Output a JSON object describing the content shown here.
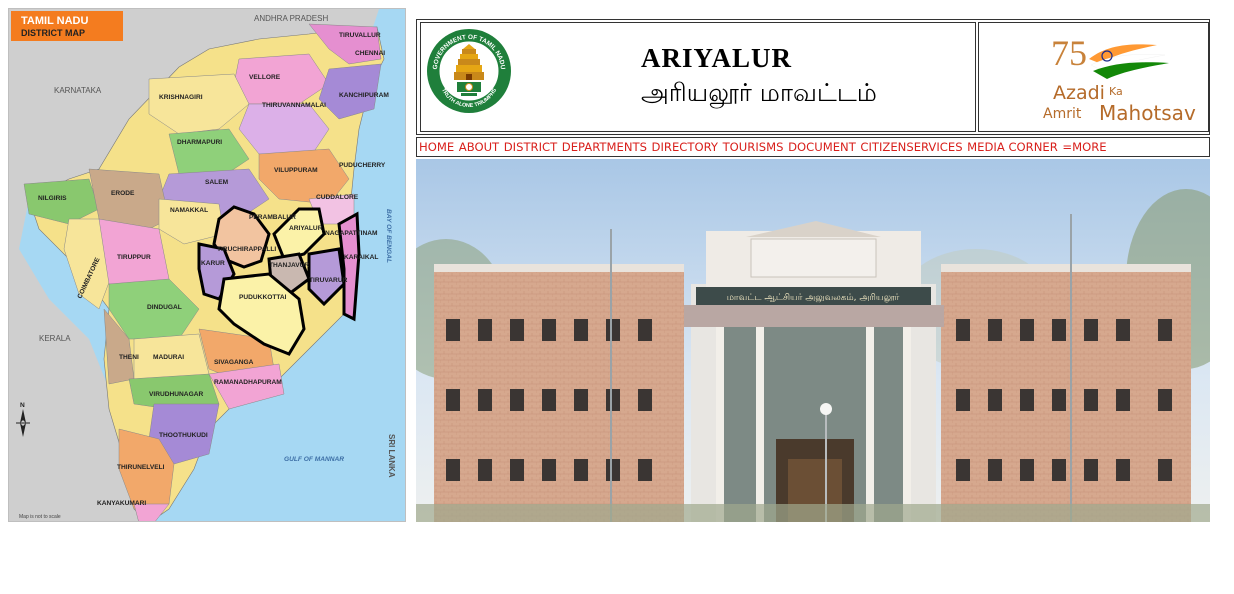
{
  "map": {
    "title_line1": "TAMIL NADU",
    "title_line2": "DISTRICT MAP",
    "note": "Map is not to scale",
    "neighbours": [
      "ANDHRA PRADESH",
      "KARNATAKA",
      "KERALA",
      "SRI LANKA"
    ],
    "seas": [
      "BAY OF BENGAL",
      "GULF OF MANNAR"
    ],
    "puducherry": "PUDUCHERRY",
    "karaikal": "KARAIKAL",
    "north_marker": "N",
    "districts": [
      "TIRUVALLUR",
      "CHENNAI",
      "VELLORE",
      "KANCHIPURAM",
      "KRISHNAGIRI",
      "THIRUVANNAMALAI",
      "DHARMAPURI",
      "VILUPPURAM",
      "SALEM",
      "CUDDALORE",
      "NILGIRIS",
      "ERODE",
      "NAMAKKAL",
      "PERAMBALUR",
      "ARIYALUR",
      "NAGAPATTINAM",
      "TIRUPPUR",
      "COIMBATORE",
      "KARUR",
      "TIRUCHIRAPPALLI",
      "THANJAVUR",
      "TIRUVARUR",
      "DINDUGAL",
      "PUDUKKOTTAI",
      "THENI",
      "MADURAI",
      "SIVAGANGA",
      "VIRUDHUNAGAR",
      "RAMANADHAPURAM",
      "THOOTHUKUDI",
      "THIRUNELVELI",
      "KANYAKUMARI"
    ],
    "highlight_color": "#000000"
  },
  "site": {
    "district_name_en": "ARIYALUR",
    "district_name_ta": "அரியலூர் மாவட்டம்",
    "emblem": {
      "top_text": "GOVERNMENT OF TAMIL NADU",
      "motto": "TRUTH ALONE TRIUMPHS",
      "icon": "tamil-nadu-emblem-icon"
    },
    "azadi": {
      "number": "75",
      "line1": "Azadi",
      "ka": "Ka",
      "line2_a": "Amrit",
      "line2_b": "Mahotsav"
    },
    "nav": [
      "HOME",
      "ABOUT",
      "DISTRICT",
      "DEPARTMENTS",
      "DIRECTORY",
      "TOURISMS",
      "DOCUMENT",
      "CITIZENSERVICES",
      "MEDIA CORNER",
      "=MORE"
    ],
    "nav_color": "#d8201c",
    "hero": {
      "building_sign": "மாவட்ட ஆட்சியர் அலுவலகம், அரியலூர்",
      "icon": "collectorate-building-photo"
    }
  }
}
